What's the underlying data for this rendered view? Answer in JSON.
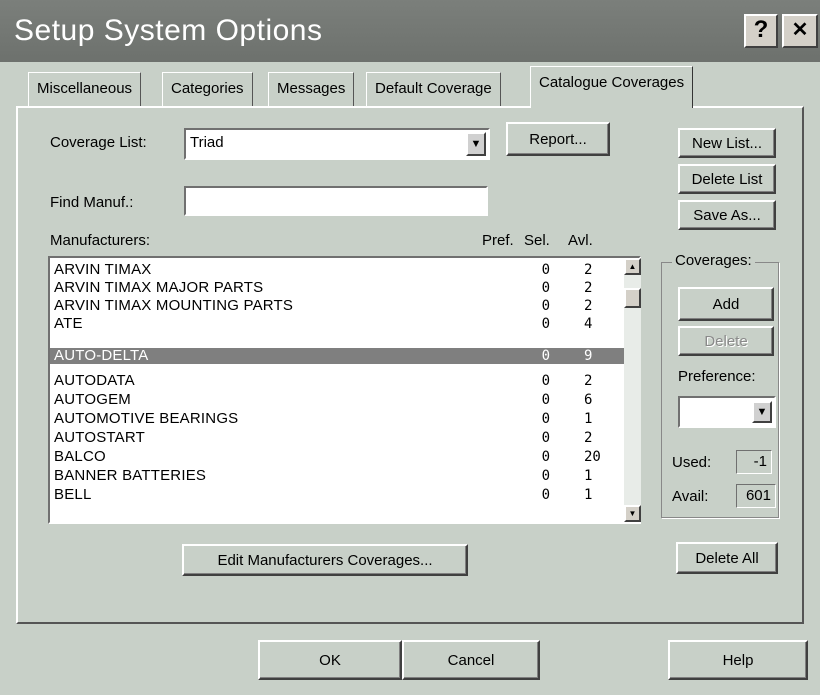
{
  "window": {
    "title": "Setup System Options",
    "help_glyph": "?",
    "close_glyph": "✕"
  },
  "tabs": [
    {
      "label": "Miscellaneous"
    },
    {
      "label": "Categories"
    },
    {
      "label": "Messages"
    },
    {
      "label": "Default Coverage"
    },
    {
      "label": "Catalogue Coverages",
      "active": true
    }
  ],
  "coverage_list": {
    "label": "Coverage List:",
    "value": "Triad"
  },
  "find_manuf": {
    "label": "Find Manuf.:",
    "value": ""
  },
  "buttons": {
    "report": "Report...",
    "new_list": "New List...",
    "delete_list": "Delete List",
    "save_as": "Save As...",
    "add": "Add",
    "delete": "Delete",
    "edit_coverages": "Edit Manufacturers Coverages...",
    "delete_all": "Delete All",
    "ok": "OK",
    "cancel": "Cancel",
    "help": "Help"
  },
  "manufacturers": {
    "label": "Manufacturers:",
    "col_pref": "Pref.",
    "col_sel": "Sel.",
    "col_avl": "Avl.",
    "rows": [
      {
        "name": "ARVIN TIMAX",
        "sel": "0",
        "avl": "2"
      },
      {
        "name": "ARVIN TIMAX MAJOR PARTS",
        "sel": "0",
        "avl": "2"
      },
      {
        "name": "ARVIN TIMAX MOUNTING PARTS",
        "sel": "0",
        "avl": "2"
      },
      {
        "name": "ATE",
        "sel": "0",
        "avl": "4"
      },
      {
        "name": "AUTO-DELTA",
        "sel": "0",
        "avl": "9",
        "selected": true
      },
      {
        "name": "AUTODATA",
        "sel": "0",
        "avl": "2"
      },
      {
        "name": "AUTOGEM",
        "sel": "0",
        "avl": "6"
      },
      {
        "name": "AUTOMOTIVE BEARINGS",
        "sel": "0",
        "avl": "1"
      },
      {
        "name": "AUTOSTART",
        "sel": "0",
        "avl": "2"
      },
      {
        "name": "BALCO",
        "sel": "0",
        "avl": "20"
      },
      {
        "name": "BANNER BATTERIES",
        "sel": "0",
        "avl": "1"
      },
      {
        "name": "BELL",
        "sel": "0",
        "avl": "1"
      }
    ]
  },
  "coverages": {
    "title": "Coverages:",
    "preference_label": "Preference:",
    "preference_value": "",
    "used_label": "Used:",
    "used_value": "-1",
    "avail_label": "Avail:",
    "avail_value": "601"
  }
}
